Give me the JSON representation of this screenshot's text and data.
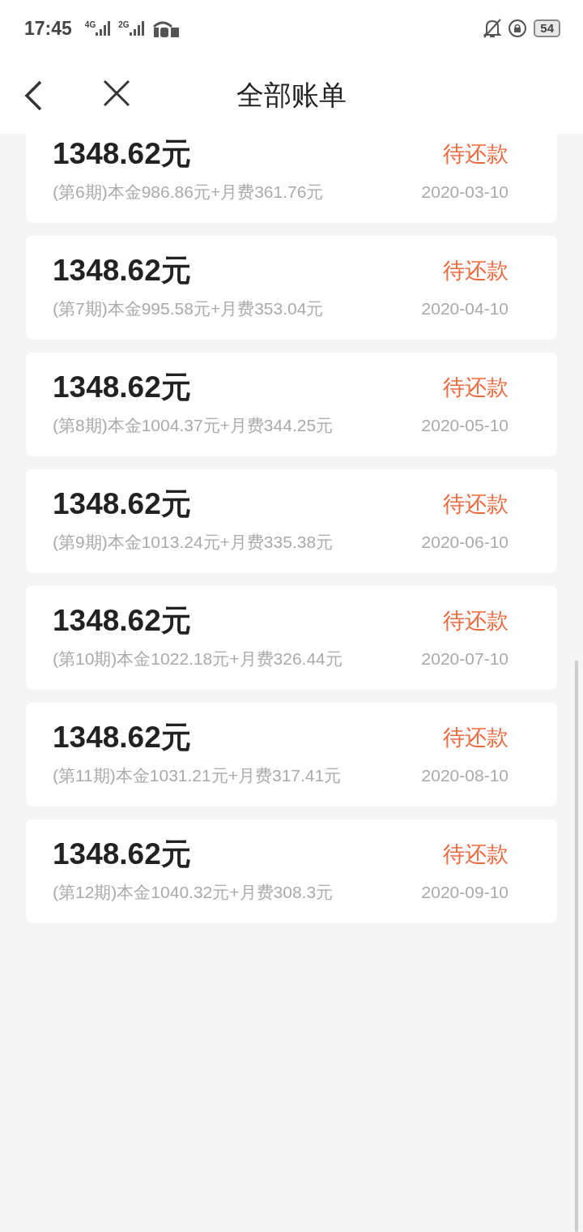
{
  "status_bar": {
    "time": "17:45",
    "network_1": "4G",
    "network_2": "2G",
    "battery": "54"
  },
  "header": {
    "title": "全部账单"
  },
  "bills": [
    {
      "amount": "1348.62元",
      "status": "待还款",
      "detail": "(第6期)本金986.86元+月费361.76元",
      "date": "2020-03-10"
    },
    {
      "amount": "1348.62元",
      "status": "待还款",
      "detail": "(第7期)本金995.58元+月费353.04元",
      "date": "2020-04-10"
    },
    {
      "amount": "1348.62元",
      "status": "待还款",
      "detail": "(第8期)本金1004.37元+月费344.25元",
      "date": "2020-05-10"
    },
    {
      "amount": "1348.62元",
      "status": "待还款",
      "detail": "(第9期)本金1013.24元+月费335.38元",
      "date": "2020-06-10"
    },
    {
      "amount": "1348.62元",
      "status": "待还款",
      "detail": "(第10期)本金1022.18元+月费326.44元",
      "date": "2020-07-10"
    },
    {
      "amount": "1348.62元",
      "status": "待还款",
      "detail": "(第11期)本金1031.21元+月费317.41元",
      "date": "2020-08-10"
    },
    {
      "amount": "1348.62元",
      "status": "待还款",
      "detail": "(第12期)本金1040.32元+月费308.3元",
      "date": "2020-09-10"
    }
  ]
}
